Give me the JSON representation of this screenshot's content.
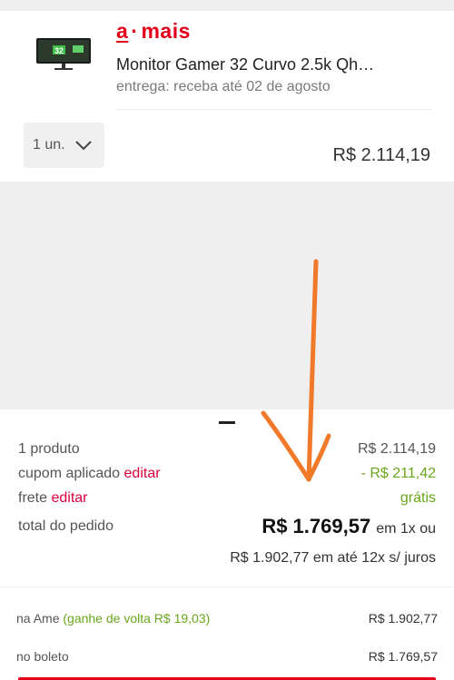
{
  "brand": {
    "a": "a",
    "rest": "mais",
    "color": "#e4001b"
  },
  "product": {
    "thumbnail_icon": "monitor-thumbnail",
    "name": "Monitor Gamer 32 Curvo 2.5k Qh…",
    "delivery": "entrega: receba até 02 de agosto",
    "quantity": "1 un.",
    "price": "R$ 2.114,19"
  },
  "summary": {
    "products_label": "1 produto",
    "products_value": "R$ 2.114,19",
    "coupon_label": "cupom aplicado",
    "coupon_edit": "editar",
    "coupon_value": "- R$ 211,42",
    "shipping_label": "frete",
    "shipping_edit": "editar",
    "shipping_value": "grátis",
    "total_label": "total do pedido",
    "total_value": "R$ 1.769,57",
    "total_suffix": "em 1x ou",
    "installments": "R$ 1.902,77 em até 12x s/ juros"
  },
  "payment": {
    "ame_label": "na Ame",
    "ame_cashback": "(ganhe de volta R$ 19,03)",
    "ame_value": "R$ 1.902,77",
    "boleto_label": "no boleto",
    "boleto_value": "R$ 1.769,57"
  },
  "colors": {
    "red": "#d7003a",
    "green": "#6aa61c",
    "annotation": "#f07a2a"
  }
}
